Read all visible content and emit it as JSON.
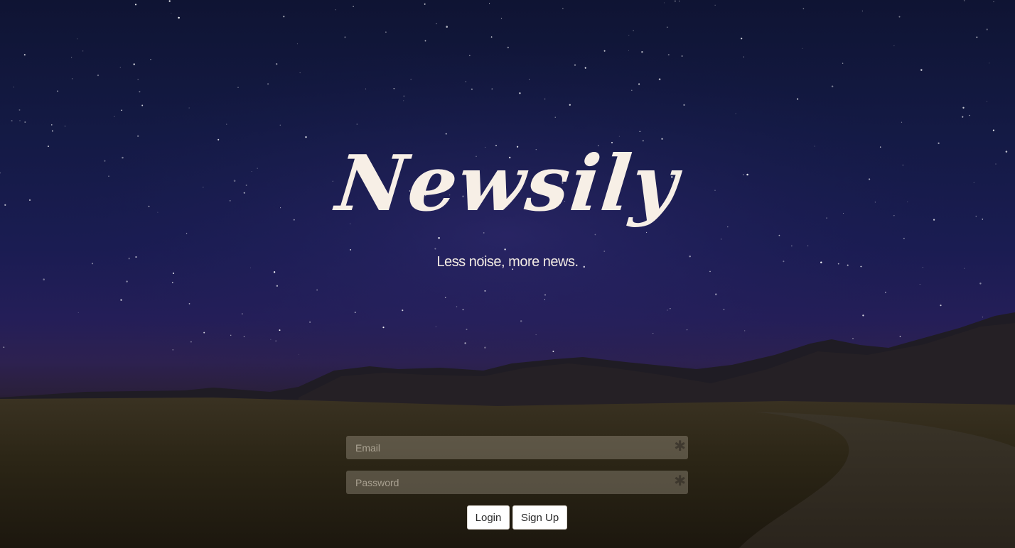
{
  "brand": {
    "logo_text": "Newsily",
    "tagline": "Less noise, more news."
  },
  "form": {
    "email_placeholder": "Email",
    "password_placeholder": "Password",
    "required_marker": "✱",
    "login_label": "Login",
    "signup_label": "Sign Up"
  },
  "colors": {
    "sky_top": "#0f1433",
    "sky_mid": "#1a1c52",
    "horizon": "#2d2150",
    "ground": "#2a2418",
    "text": "#f7efe6",
    "button_bg": "#ffffff"
  }
}
